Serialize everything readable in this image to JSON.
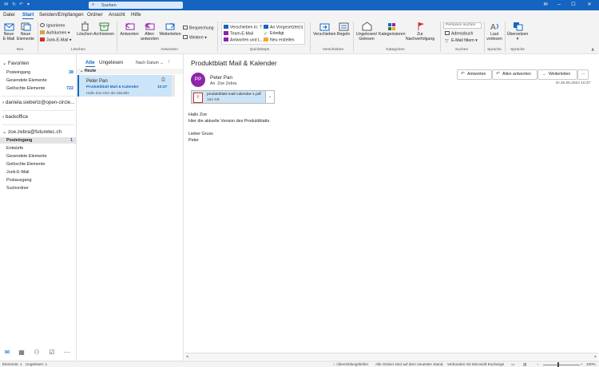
{
  "titlebar": {
    "search_placeholder": "Suchen",
    "accent_color": "#1565c0"
  },
  "menu": {
    "items": [
      "Datei",
      "Start",
      "Senden/Empfangen",
      "Ordner",
      "Ansicht",
      "Hilfe"
    ],
    "active": "Start"
  },
  "ribbon": {
    "new_email": "Neue\nE-Mail",
    "new_items": "Neue\nElemente",
    "ignore": "Ignorieren",
    "cleanup": "Aufräumen",
    "junk": "Junk-E-Mail",
    "delete": "Löschen",
    "archive": "Archivieren",
    "reply": "Antworten",
    "reply_all": "Allen\nantworten",
    "forward": "Weiterleiten",
    "meeting": "Besprechung",
    "more": "Weitere",
    "qs_move": "Verschieben in: ?",
    "qs_team": "Team-E-Mail",
    "qs_reply_delete": "Antworten und L...",
    "qs_manager": "An Vorgesetzte(n)",
    "qs_done": "Erledigt",
    "qs_new": "Neu erstellen",
    "move": "Verschieben",
    "rules": "Regeln",
    "unread_read": "Ungelesen/\nGelesen",
    "categorize": "Kategorisieren",
    "followup": "Zur\nNachverfolgung",
    "people_search": "Personen suchen",
    "address_book": "Adressbuch",
    "filter_email": "E-Mail filtern",
    "read_aloud": "Laut\nvorlesen",
    "translate": "Übersetzen",
    "groups": {
      "new": "Neu",
      "delete": "Löschen",
      "respond": "Antworten",
      "quicksteps": "QuickSteps",
      "move": "Verschieben",
      "tags": "Kategorien",
      "find": "Suchen",
      "speech": "Sprache",
      "language": "Sprache"
    }
  },
  "nav": {
    "favorites_label": "Favoriten",
    "favorites": [
      {
        "name": "Posteingang",
        "count": "38"
      },
      {
        "name": "Gesendete Elemente",
        "count": ""
      },
      {
        "name": "Gelöschte Elemente",
        "count": "722"
      }
    ],
    "account1": "daniela.siebertz@open-circle...",
    "account2": "backoffice",
    "account3": "zoe.zebra@futuretec.ch",
    "folders": [
      {
        "name": "Posteingang",
        "count": "1"
      },
      {
        "name": "Entwürfe",
        "count": ""
      },
      {
        "name": "Gesendete Elemente",
        "count": ""
      },
      {
        "name": "Gelöschte Elemente",
        "count": ""
      },
      {
        "name": "Junk-E-Mail",
        "count": ""
      },
      {
        "name": "Postausgang",
        "count": ""
      },
      {
        "name": "Suchordner",
        "count": ""
      }
    ]
  },
  "message_list": {
    "tab_all": "Alle",
    "tab_unread": "Ungelesen",
    "sort": "Nach Datum",
    "group": "Heute",
    "message": {
      "from": "Peter Pan",
      "subject": "Produktblatt Mail & Kalender",
      "preview": "Hallo Zoe  Hier die aktuelle",
      "time": "10:37"
    }
  },
  "reading_pane": {
    "subject": "Produktblatt Mail & Kalender",
    "avatar_initials": "PP",
    "avatar_color": "#8e24aa",
    "from": "Peter Pan",
    "to_label": "An",
    "to": "Zoe Zebra",
    "btn_reply": "Antworten",
    "btn_reply_all": "Allen antworten",
    "btn_forward": "Weiterleiten",
    "date": "Di 25.06.2024 10:37",
    "attachment_name": "produktblatt-mail-calendar-1.pdf",
    "attachment_size": "162 KB",
    "body": [
      "Hallo Zoe",
      "Hier die aktuelle Version des Produktblatts",
      "",
      "Lieber Gruss",
      "Peter"
    ]
  },
  "status": {
    "items": "Elemente: 1",
    "unread": "Ungelesen: 1",
    "warning": "Übermittlungsfehler",
    "folders_updated": "Alle Ordner sind auf dem neuesten Stand.",
    "connected": "Verbunden mit Microsoft Exchange",
    "zoom": "100%"
  }
}
